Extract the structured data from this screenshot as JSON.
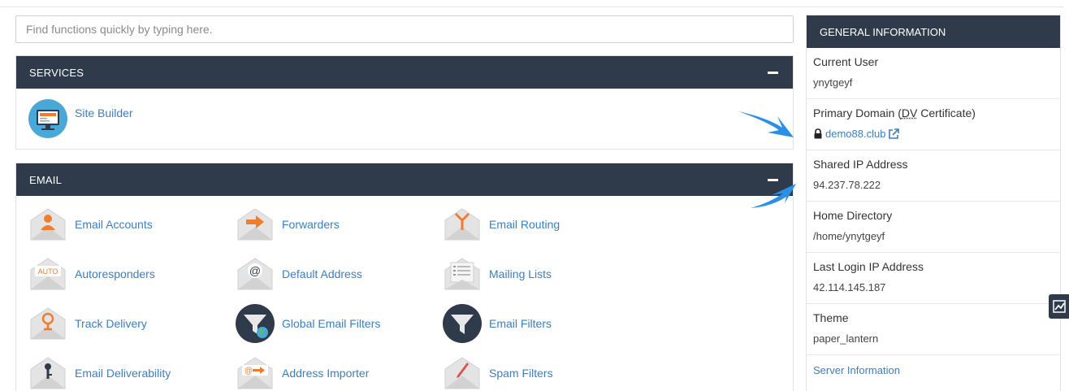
{
  "search": {
    "placeholder": "Find functions quickly by typing here."
  },
  "services": {
    "title": "SERVICES",
    "items": [
      {
        "label": "Site Builder",
        "icon": "site-builder-icon"
      }
    ]
  },
  "email": {
    "title": "EMAIL",
    "items": [
      {
        "label": "Email Accounts",
        "icon": "email-accounts-icon"
      },
      {
        "label": "Forwarders",
        "icon": "forwarders-icon"
      },
      {
        "label": "Email Routing",
        "icon": "email-routing-icon"
      },
      {
        "label": "Autoresponders",
        "icon": "autoresponders-icon",
        "badge": "AUTO"
      },
      {
        "label": "Default Address",
        "icon": "default-address-icon",
        "badge": "@"
      },
      {
        "label": "Mailing Lists",
        "icon": "mailing-lists-icon"
      },
      {
        "label": "Track Delivery",
        "icon": "track-delivery-icon"
      },
      {
        "label": "Global Email Filters",
        "icon": "global-email-filters-icon"
      },
      {
        "label": "Email Filters",
        "icon": "email-filters-icon"
      },
      {
        "label": "Email Deliverability",
        "icon": "email-deliverability-icon"
      },
      {
        "label": "Address Importer",
        "icon": "address-importer-icon",
        "badge": "@"
      },
      {
        "label": "Spam Filters",
        "icon": "spam-filters-icon"
      }
    ]
  },
  "general": {
    "title": "GENERAL INFORMATION",
    "current_user": {
      "label": "Current User",
      "value": "ynytgeyf"
    },
    "primary_domain": {
      "label_prefix": "Primary Domain (",
      "label_dv": "DV",
      "label_suffix": " Certificate)",
      "value": "demo88.club"
    },
    "shared_ip": {
      "label": "Shared IP Address",
      "value": "94.237.78.222"
    },
    "home_directory": {
      "label": "Home Directory",
      "value": "/home/ynytgeyf"
    },
    "last_login": {
      "label": "Last Login IP Address",
      "value": "42.114.145.187"
    },
    "theme": {
      "label": "Theme",
      "value": "paper_lantern"
    },
    "server_info_link": "Server Information"
  },
  "colors": {
    "header_bg": "#2f3b4b",
    "link": "#3a7fc6",
    "accent_orange": "#f07d2d",
    "arrow_blue": "#2a8fe6"
  }
}
